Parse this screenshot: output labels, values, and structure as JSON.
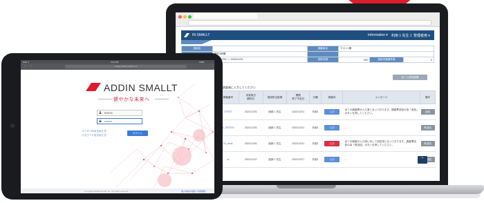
{
  "colors": {
    "brand_red": "#e01b2c",
    "app_header": "#1f4f7f",
    "table_header": "#5e8bbf",
    "link_blue": "#3a73c2"
  },
  "laptop": {
    "app": {
      "title": "IN SMALLT",
      "user_menu": "Information ▾",
      "user_name": "利用 1 先生 1",
      "user_role": "管理者用 ▾"
    },
    "info_table": {
      "row1": {
        "h1": "施設名",
        "v1": "",
        "h2": "調査時名",
        "v2": "マスト1期"
      },
      "row2": {
        "h1": "",
        "v1": "期日1時間",
        "h2": "",
        "v2": ""
      },
      "row3": {
        "h1": "",
        "v1": "2021/12/01 〜 2040/12/31",
        "h2": "契約状態",
        "v2": "500",
        "h3": "施設内最適件数",
        "v3": "0"
      }
    },
    "ghost_button": "全ー入状況結果",
    "table_title": "下の調査者に入力してください",
    "columns": [
      "調査番号",
      "未実施日\n解除日",
      "施設担当医師",
      "期限\n終了予定日",
      "分類",
      "調査状",
      "メッセージ",
      "操作"
    ],
    "rows": [
      {
        "id": "ZTEST",
        "date": "2021/12/31",
        "doctor": "医師 1 先生",
        "due": "2202/12/31",
        "kind": "外部1",
        "status": "入力",
        "status_color": "blue",
        "message": "全ての調査票が入力済となっております。調査票送信の為「送信」ボタンを押してください。",
        "action": "送信"
      },
      {
        "id": "4_TEST03",
        "date": "2021/12/31",
        "doctor": "医師 1 先生",
        "due": "2202/12/31",
        "kind": "外部1",
        "status": "入力",
        "status_color": "blue",
        "message": "--",
        "action": "再送信"
      },
      {
        "id": "04_test1",
        "date": "2021/12/01",
        "doctor": "医師 1 先生",
        "due": "2202/12/31",
        "kind": "外部1",
        "status": "入力",
        "status_color": "red",
        "message": "全ての調査が入力済に対して回答済となっております。調査票送信の為「再送信」ボタンを押してください。",
        "action": "再送信"
      },
      {
        "id": "zz",
        "date": "2021/12/27",
        "doctor": "医師 1 先生",
        "due": "2202/12/27",
        "kind": "外部1",
        "status": "入力",
        "status_color": "blue",
        "message": "--",
        "action": "再送信"
      }
    ],
    "scroll_up_icon": "chevron-up-icon"
  },
  "tablet": {
    "status_left": "iPad ✦",
    "status_time": "4:31 PM",
    "status_right": "100%",
    "url": "mdapp.addin-smallt.com",
    "brand": "ADDIN SMALLT",
    "tagline": "健やかな未来へ",
    "user_value": "B2578",
    "password_value": "••••••••",
    "links": [
      "ユーザーIDを忘れた方",
      "パスワードを忘れた方"
    ],
    "login_button": "ログイン",
    "footer_left": "Copyright ADDIN SmallT Inc. All rights reserved.",
    "footer_right": "個人情報の取扱 / 利用規約"
  }
}
